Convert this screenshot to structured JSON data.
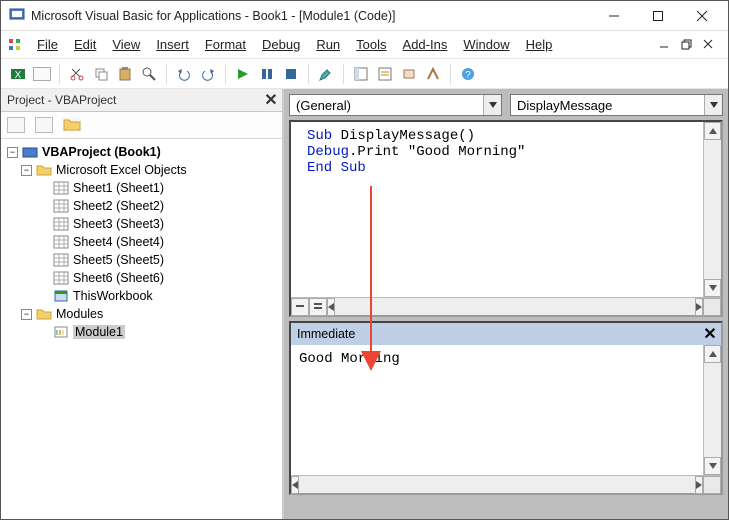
{
  "window": {
    "title": "Microsoft Visual Basic for Applications - Book1 - [Module1 (Code)]"
  },
  "menu": {
    "file": "File",
    "edit": "Edit",
    "view": "View",
    "insert": "Insert",
    "format": "Format",
    "debug": "Debug",
    "run": "Run",
    "tools": "Tools",
    "addins": "Add-Ins",
    "window": "Window",
    "help": "Help"
  },
  "project_panel": {
    "title": "Project - VBAProject"
  },
  "tree": {
    "root": "VBAProject (Book1)",
    "excel_objects_label": "Microsoft Excel Objects",
    "sheets": [
      "Sheet1 (Sheet1)",
      "Sheet2 (Sheet2)",
      "Sheet3 (Sheet3)",
      "Sheet4 (Sheet4)",
      "Sheet5 (Sheet5)",
      "Sheet6 (Sheet6)"
    ],
    "thisworkbook": "ThisWorkbook",
    "modules_label": "Modules",
    "module1": "Module1"
  },
  "dropdowns": {
    "scope": "(General)",
    "proc": "DisplayMessage"
  },
  "code": {
    "l1a": "Sub",
    "l1b": " DisplayMessage()",
    "l2a": "Debug",
    "l2b": ".Print ",
    "l2c": "\"Good Morning\"",
    "l3a": "End Sub"
  },
  "immediate": {
    "title": "Immediate",
    "output": "Good Morning"
  }
}
